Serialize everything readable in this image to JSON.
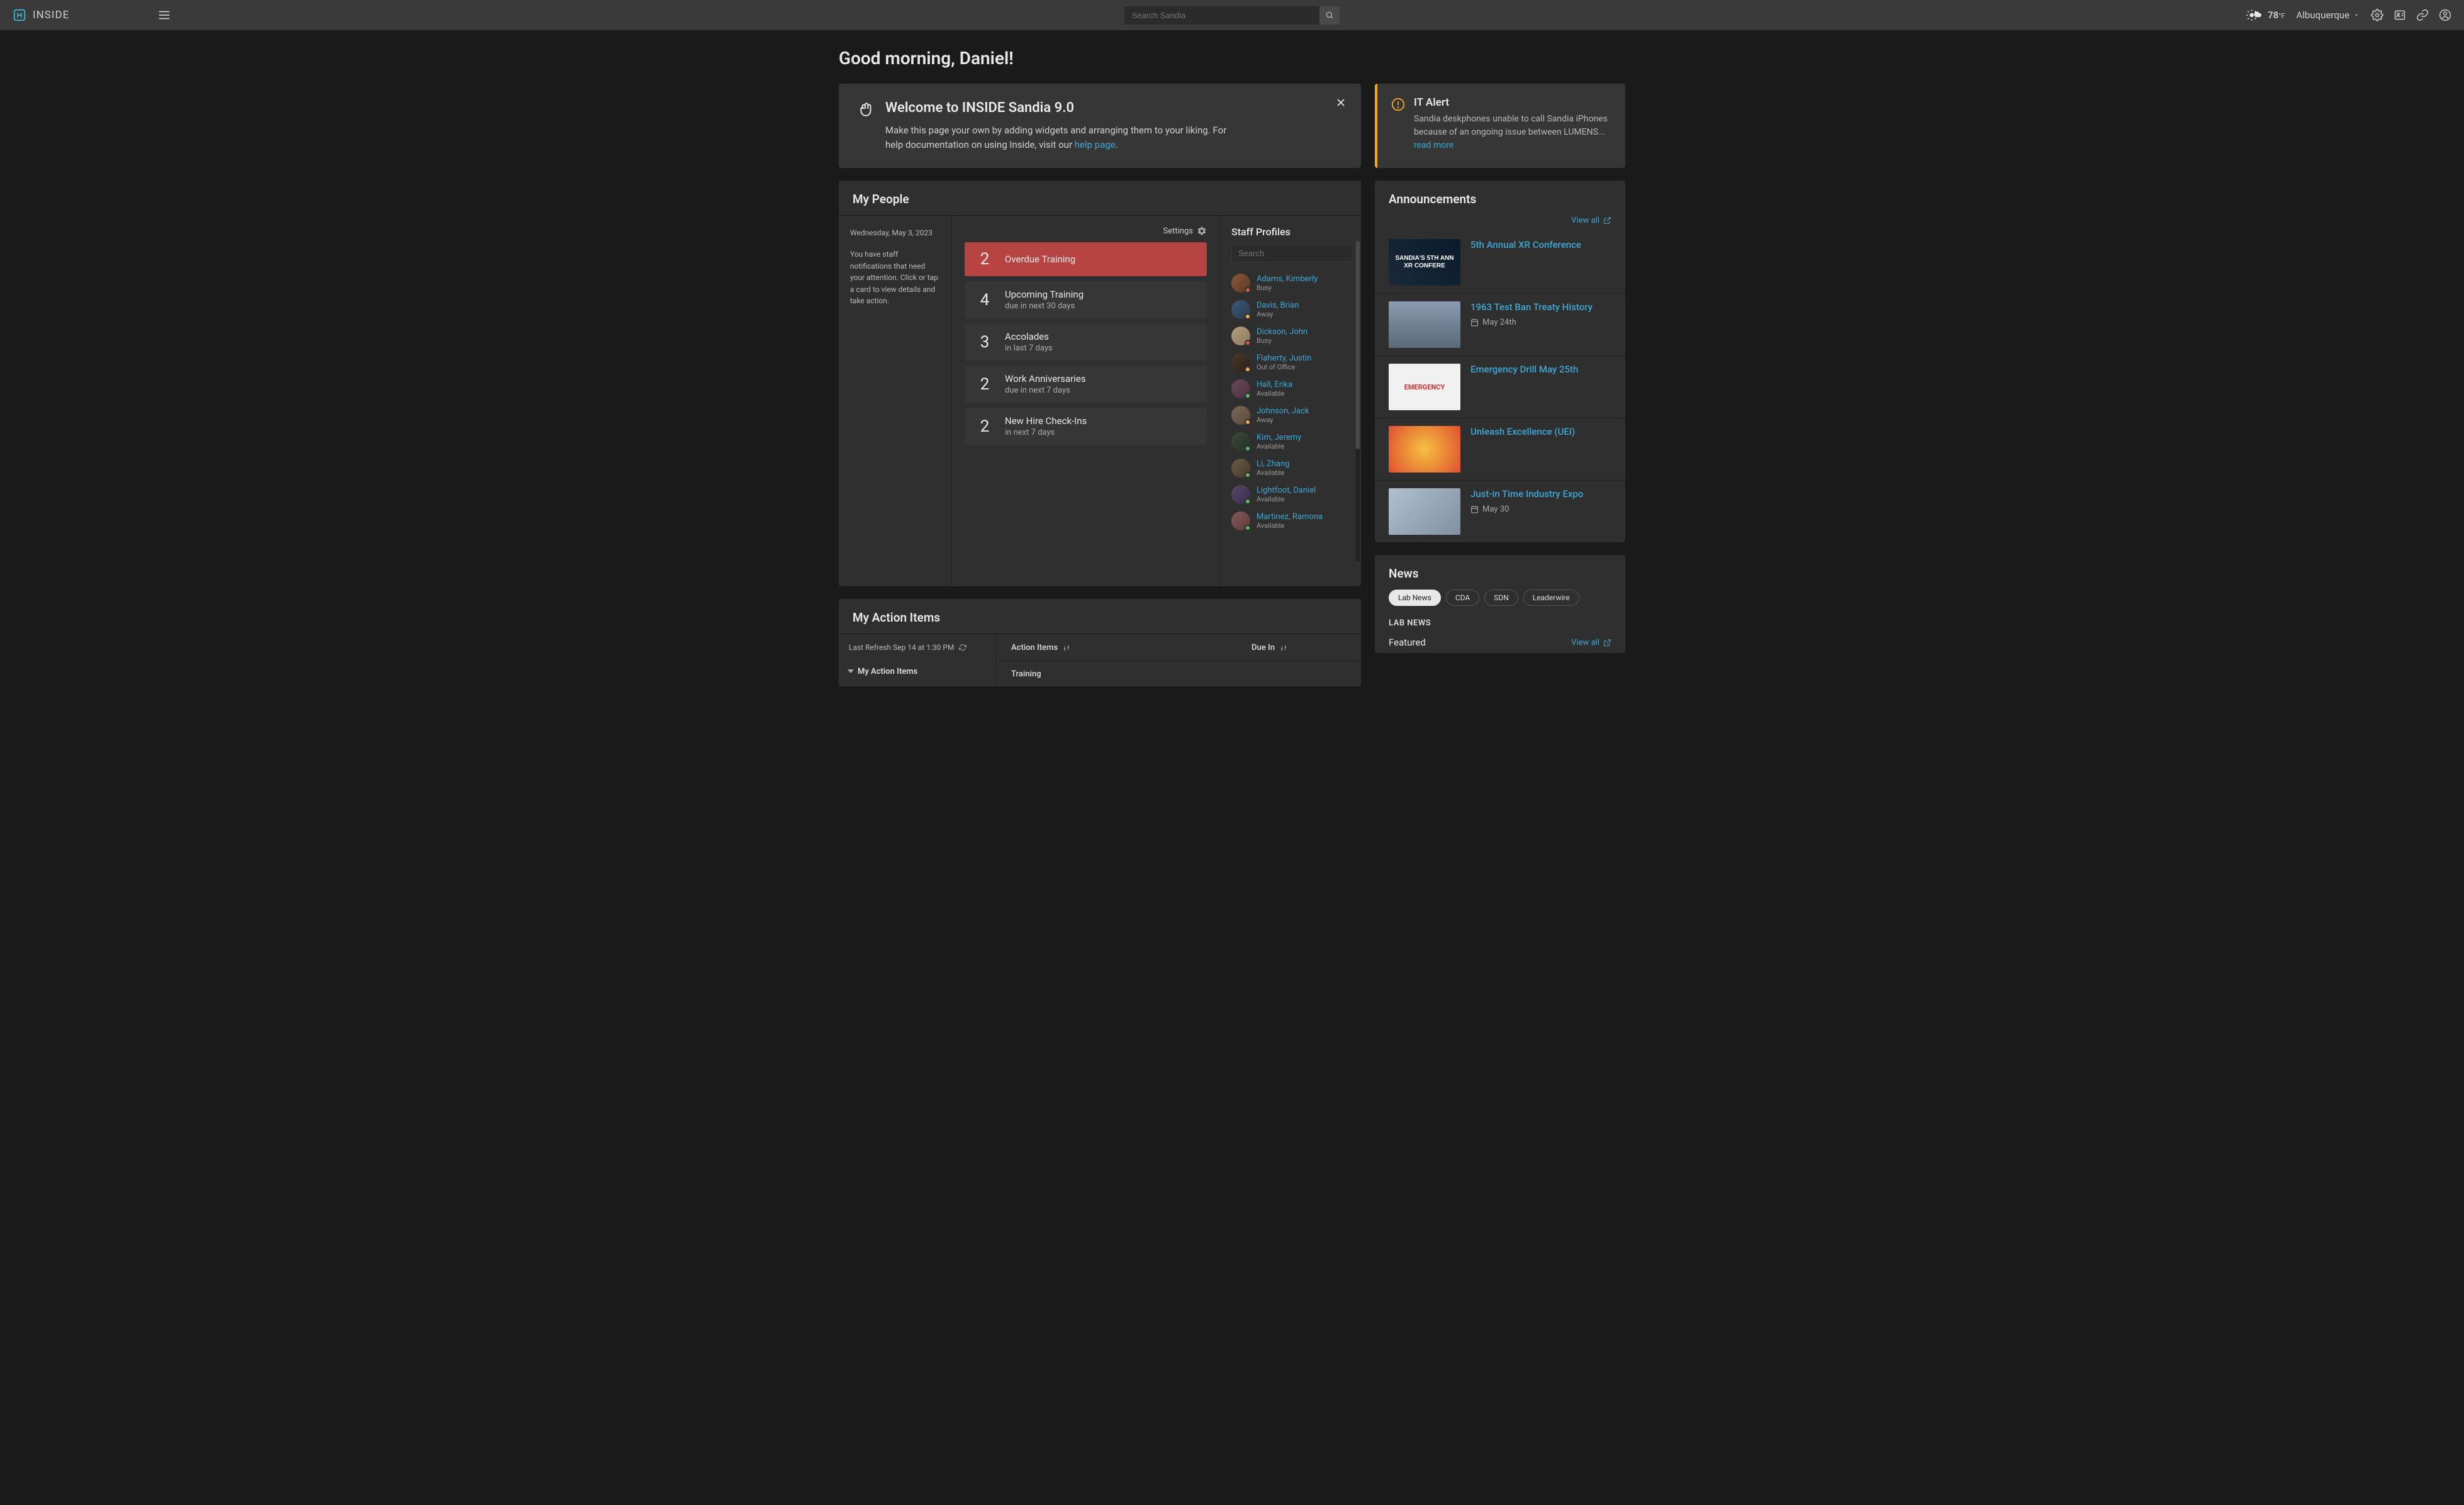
{
  "header": {
    "brand": "INSIDE",
    "search_placeholder": "Search Sandia",
    "weather_temp": "78",
    "weather_unit": "°F",
    "location": "Albuquerque"
  },
  "greeting": "Good morning, Daniel!",
  "welcome": {
    "title": "Welcome to INSIDE Sandia 9.0",
    "body_1": "Make this page your own by adding widgets and arranging them to your liking. For help documentation on using Inside, visit our ",
    "link": "help page",
    "body_2": "."
  },
  "alert": {
    "title": "IT Alert",
    "body": "Sandia deskphones unable to call Sandia iPhones because of an ongoing issue between LUMENS... ",
    "link": "read more"
  },
  "people": {
    "header": "My People",
    "date": "Wednesday, May 3, 2023",
    "notice": "You have staff notifications that need your attention. Click or tap a card to view details and take action.",
    "settings_label": "Settings",
    "cards": [
      {
        "num": "2",
        "title": "Overdue Training",
        "sub": "",
        "red": true
      },
      {
        "num": "4",
        "title": "Upcoming Training",
        "sub": "due in next 30 days"
      },
      {
        "num": "3",
        "title": "Accolades",
        "sub": "in last 7 days"
      },
      {
        "num": "2",
        "title": "Work Anniversaries",
        "sub": "due in next 7 days"
      },
      {
        "num": "2",
        "title": "New Hire Check-Ins",
        "sub": "in next 7 days"
      }
    ],
    "profiles_header": "Staff Profiles",
    "profiles_search_placeholder": "Search",
    "profiles": [
      {
        "name": "Adams, Kimberly",
        "status": "Busy",
        "dot": "busy"
      },
      {
        "name": "Davis, Brian",
        "status": "Away",
        "dot": "away"
      },
      {
        "name": "Dickson, John",
        "status": "Busy",
        "dot": "busy"
      },
      {
        "name": "Flaherty, Justin",
        "status": "Out of Office",
        "dot": "away"
      },
      {
        "name": "Hall, Erika",
        "status": "Available",
        "dot": "avail"
      },
      {
        "name": "Johnson, Jack",
        "status": "Away",
        "dot": "away"
      },
      {
        "name": "Kim, Jeremy",
        "status": "Available",
        "dot": "avail"
      },
      {
        "name": "Li, Zhang",
        "status": "Available",
        "dot": "avail"
      },
      {
        "name": "Lightfoot, Daniel",
        "status": "Available",
        "dot": "avail"
      },
      {
        "name": "Martinez, Ramona",
        "status": "Available",
        "dot": "avail"
      }
    ]
  },
  "actions": {
    "header": "My Action Items",
    "refresh": "Last Refresh Sep 14 at 1:30 PM",
    "tree_label": "My Action Items",
    "col_action": "Action Items",
    "col_due": "Due In",
    "row_training": "Training"
  },
  "announcements": {
    "header": "Announcements",
    "view_all": "View all",
    "items": [
      {
        "title": "5th Annual XR Conference",
        "date": ""
      },
      {
        "title": "1963 Test Ban Treaty History",
        "date": "May 24th"
      },
      {
        "title": "Emergency Drill May 25th",
        "date": ""
      },
      {
        "title": "Unleash Excellence (UEI)",
        "date": ""
      },
      {
        "title": "Just-in Time Industry Expo",
        "date": "May 30"
      }
    ]
  },
  "news": {
    "header": "News",
    "pills": [
      "Lab News",
      "CDA",
      "SDN",
      "Leaderwire"
    ],
    "active_pill": 0,
    "label": "LAB NEWS",
    "featured": "Featured",
    "view_all": "View all"
  }
}
